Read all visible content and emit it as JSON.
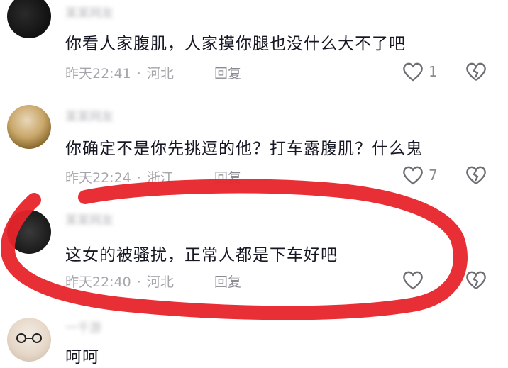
{
  "comments": [
    {
      "username": "某某网友",
      "text": "你看人家腹肌，人家摸你腿也没什么大不了吧",
      "time": "昨天22:41",
      "location": "河北",
      "reply_label": "回复",
      "likes": "1"
    },
    {
      "username": "某某网友",
      "text": "你确定不是你先挑逗的他？打车露腹肌？什么鬼",
      "time": "昨天22:24",
      "location": "浙江",
      "reply_label": "回复",
      "likes": "7"
    },
    {
      "username": "某某网友",
      "text": "这女的被骚扰，正常人都是下车好吧",
      "time": "昨天22:40",
      "location": "河北",
      "reply_label": "回复",
      "likes": ""
    },
    {
      "username": "一千游",
      "text": "呵呵"
    }
  ],
  "meta_separator": "·",
  "icons": {
    "like": "heart-outline-icon",
    "dislike": "broken-heart-icon"
  },
  "colors": {
    "annotation_red": "#e8242b",
    "text_primary": "#161823",
    "text_secondary": "#a5a6ab"
  }
}
